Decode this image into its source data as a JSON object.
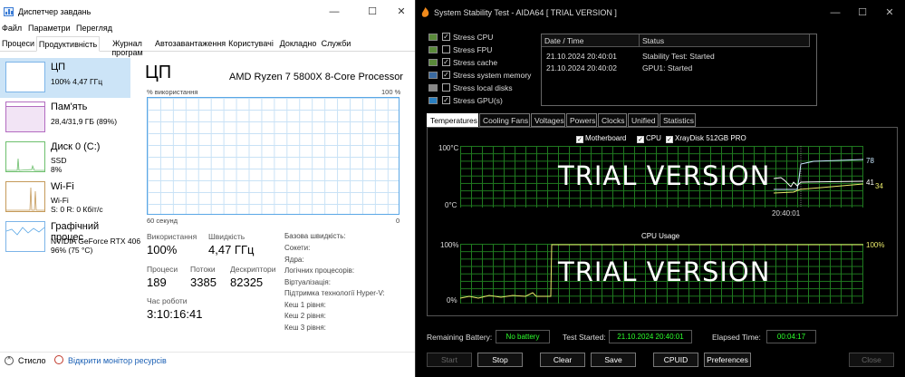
{
  "taskmanager": {
    "title": "Диспетчер завдань",
    "menu": [
      "Файл",
      "Параметри",
      "Перегляд"
    ],
    "tabs": [
      "Процеси",
      "Продуктивність",
      "Журнал програм",
      "Автозавантаження",
      "Користувачі",
      "Докладно",
      "Служби"
    ],
    "active_tab": "Продуктивність",
    "sidebar": [
      {
        "name": "ЦП",
        "line1": "100% 4,47 ГГц",
        "line2": ""
      },
      {
        "name": "Пам'ять",
        "line1": "28,4/31,9 ГБ (89%)",
        "line2": ""
      },
      {
        "name": "Диск 0 (C:)",
        "line1": "SSD",
        "line2": "8%"
      },
      {
        "name": "Wi-Fi",
        "line1": "Wi-Fi",
        "line2": "S: 0 R: 0 Кбіт/с"
      },
      {
        "name": "Графічний процес",
        "line1": "NVIDIA GeForce RTX 406",
        "line2": "96% (75 °C)"
      }
    ],
    "main": {
      "heading": "ЦП",
      "model": "AMD Ryzen 7 5800X 8-Core Processor",
      "graph_label_left": "% використання",
      "graph_label_right": "100 %",
      "graph_bottom_left": "60 секунд",
      "graph_bottom_right": "0",
      "utilization_label": "Використання",
      "utilization_value": "100%",
      "speed_label": "Швидкість",
      "speed_value": "4,47 ГГц",
      "processes_label": "Процеси",
      "processes_value": "189",
      "threads_label": "Потоки",
      "threads_value": "3385",
      "handles_label": "Дескриптори",
      "handles_value": "82325",
      "uptime_label": "Час роботи",
      "uptime_value": "3:10:16:41",
      "specs": [
        "Базова швидкість:",
        "Сокети:",
        "Ядра:",
        "Логічних процесорів:",
        "Віртуалізація:",
        "Підтримка технології Hyper-V:",
        "Кеш 1 рівня:",
        "Кеш 2 рівня:",
        "Кеш 3 рівня:"
      ]
    },
    "footer": {
      "less": "Стисло",
      "monitor": "Відкрити монітор ресурсів"
    }
  },
  "aida": {
    "title": "System Stability Test - AIDA64  [ TRIAL VERSION ]",
    "options": [
      {
        "label": "Stress CPU",
        "checked": "✓"
      },
      {
        "label": "Stress FPU",
        "checked": ""
      },
      {
        "label": "Stress cache",
        "checked": "✓"
      },
      {
        "label": "Stress system memory",
        "checked": "✓"
      },
      {
        "label": "Stress local disks",
        "checked": ""
      },
      {
        "label": "Stress GPU(s)",
        "checked": "✓"
      }
    ],
    "log_headers": [
      "Date / Time",
      "Status"
    ],
    "log_rows": [
      {
        "time": "21.10.2024 20:40:01",
        "status": "Stability Test: Started"
      },
      {
        "time": "21.10.2024 20:40:02",
        "status": "GPU1: Started"
      }
    ],
    "tabs": [
      "Temperatures",
      "Cooling Fans",
      "Voltages",
      "Powers",
      "Clocks",
      "Unified",
      "Statistics"
    ],
    "active_tab": "Temperatures",
    "legend": [
      "Motherboard",
      "CPU",
      "XrayDisk 512GB PRO"
    ],
    "trial_text": "TRIAL VERSION",
    "temp_axis": {
      "top": "100°C",
      "bottom": "0°C",
      "time": "20:40:01"
    },
    "temp_values": [
      "78",
      "41",
      "34"
    ],
    "usage_title": "CPU Usage",
    "usage_axis": {
      "top_left": "100%",
      "bottom_left": "0%",
      "top_right": "100%"
    },
    "status": {
      "battery_label": "Remaining Battery:",
      "battery_value": "No battery",
      "started_label": "Test Started:",
      "started_value": "21.10.2024 20:40:01",
      "elapsed_label": "Elapsed Time:",
      "elapsed_value": "00:04:17"
    },
    "buttons": [
      "Start",
      "Stop",
      "Clear",
      "Save",
      "CPUID",
      "Preferences",
      "Close"
    ],
    "colors": {
      "grid": "#1f7a1f",
      "value": "#2cff2c",
      "series_mb": "#ffffff",
      "series_cpu": "#9be0ff",
      "series_disk": "#e8e86a"
    }
  }
}
